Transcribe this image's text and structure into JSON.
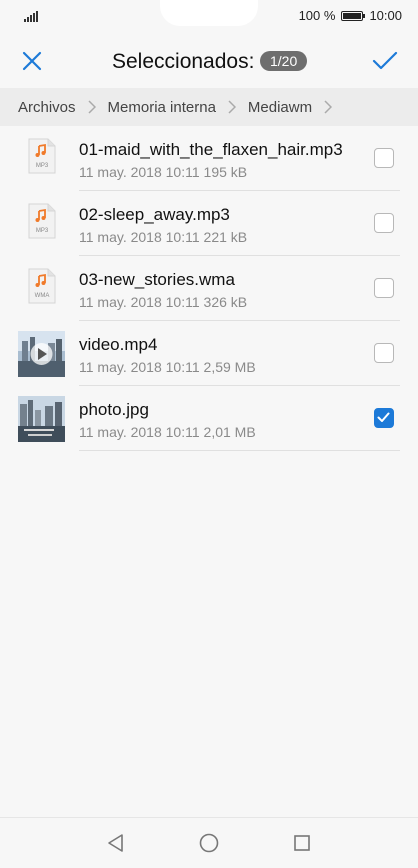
{
  "status_bar": {
    "battery_percent_label": "100 %",
    "time": "10:00"
  },
  "header": {
    "title": "Seleccionados:",
    "count_badge": "1/20"
  },
  "breadcrumb": [
    "Archivos",
    "Memoria interna",
    "Mediawm"
  ],
  "files": [
    {
      "name": "01-maid_with_the_flaxen_hair.mp3",
      "meta": "11 may. 2018 10:11 195 kB",
      "type_label": "MP3",
      "icon": "music-file-icon",
      "checked": false
    },
    {
      "name": "02-sleep_away.mp3",
      "meta": "11 may. 2018 10:11 221 kB",
      "type_label": "MP3",
      "icon": "music-file-icon",
      "checked": false
    },
    {
      "name": "03-new_stories.wma",
      "meta": "11 may. 2018 10:11 326 kB",
      "type_label": "WMA",
      "icon": "music-file-icon",
      "checked": false
    },
    {
      "name": "video.mp4",
      "meta": "11 may. 2018 10:11 2,59 MB",
      "icon": "video-thumbnail",
      "checked": false
    },
    {
      "name": "photo.jpg",
      "meta": "11 may. 2018 10:11 2,01 MB",
      "icon": "photo-thumbnail",
      "checked": true
    }
  ],
  "colors": {
    "accent": "#1d7ad8",
    "music_icon": "#f07a2a",
    "badge": "#6e6e6e"
  }
}
